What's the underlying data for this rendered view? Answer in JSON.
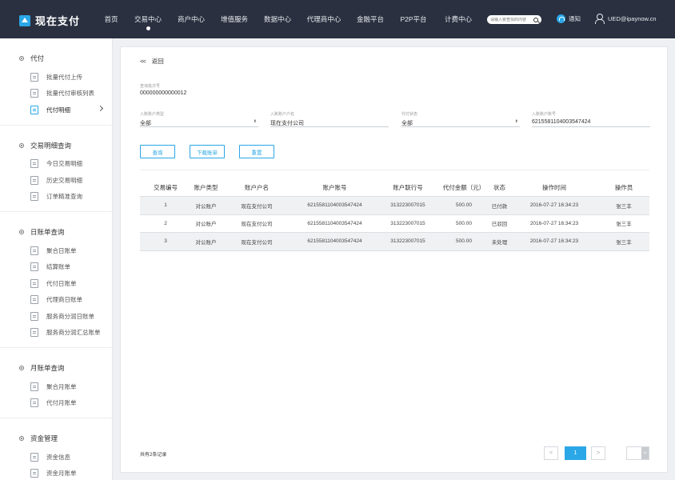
{
  "brand": {
    "name": "现在支付"
  },
  "nav": [
    {
      "label": "首页"
    },
    {
      "label": "交易中心",
      "active": true
    },
    {
      "label": "商户中心"
    },
    {
      "label": "增值服务"
    },
    {
      "label": "数据中心"
    },
    {
      "label": "代理商中心"
    },
    {
      "label": "金融平台"
    },
    {
      "label": "P2P平台"
    },
    {
      "label": "计费中心"
    }
  ],
  "search": {
    "placeholder": "请输入要查找的内容"
  },
  "notice": {
    "label": "通知"
  },
  "user": {
    "email": "UED@ipaynow.cn"
  },
  "sidebar": [
    {
      "title": "代付",
      "items": [
        {
          "label": "批量代付上传"
        },
        {
          "label": "批量代付审核列表"
        },
        {
          "label": "代付明细",
          "active": true
        }
      ]
    },
    {
      "title": "交易明细查询",
      "items": [
        {
          "label": "今日交易明细"
        },
        {
          "label": "历史交易明细"
        },
        {
          "label": "订单精准查询"
        }
      ]
    },
    {
      "title": "日账单查询",
      "items": [
        {
          "label": "聚合日账单"
        },
        {
          "label": "结算账单"
        },
        {
          "label": "代付日账单"
        },
        {
          "label": "代理商日账单"
        },
        {
          "label": "服务商分润日账单"
        },
        {
          "label": "服务商分润汇总账单"
        }
      ]
    },
    {
      "title": "月账单查询",
      "items": [
        {
          "label": "聚合月账单"
        },
        {
          "label": "代付月账单"
        }
      ]
    },
    {
      "title": "资金管理",
      "items": [
        {
          "label": "资金信息"
        },
        {
          "label": "资金月账单"
        }
      ]
    }
  ],
  "main": {
    "back_label": "返回",
    "back_arrows": "<<",
    "batch_label": "查询批次号",
    "batch_value": "000000000000012",
    "filters": [
      {
        "label": "入账账户类型",
        "value": "全部",
        "select": true
      },
      {
        "label": "入账账户户名",
        "value": "现在支付公司",
        "select": false
      },
      {
        "label": "代付状态",
        "value": "全部",
        "select": true
      },
      {
        "label": "入账账户账号",
        "value": "6215581104003547424",
        "select": false
      }
    ],
    "buttons": {
      "query": "查询",
      "download": "下载账单",
      "reset": "重置"
    },
    "table": {
      "headers": [
        "交易编号",
        "账户类型",
        "账户户名",
        "账户账号",
        "账户联行号",
        "代付金额（元）",
        "状态",
        "操作时间",
        "操作员"
      ],
      "rows": [
        [
          "1",
          "对公账户",
          "现在支付公司",
          "6215581104003547424",
          "313223007015",
          "500.00",
          "已付款",
          "2016-07-27  16:34:23",
          "张三丰"
        ],
        [
          "2",
          "对公账户",
          "现在支付公司",
          "6215581104003547424",
          "313223007015",
          "500.00",
          "已驳回",
          "2016-07-27  16:34:23",
          "张三丰"
        ],
        [
          "3",
          "对公账户",
          "现在支付公司",
          "6215581104003547424",
          "313223007015",
          "500.00",
          "未处理",
          "2016-07-27  16:34:23",
          "张三丰"
        ]
      ]
    },
    "total_label": "共有2条记录",
    "pagination": {
      "prev": "<",
      "current": "1",
      "next": ">",
      "go": ">"
    }
  },
  "colors": {
    "accent": "#2aa7e6",
    "topbar": "#2a3040"
  }
}
